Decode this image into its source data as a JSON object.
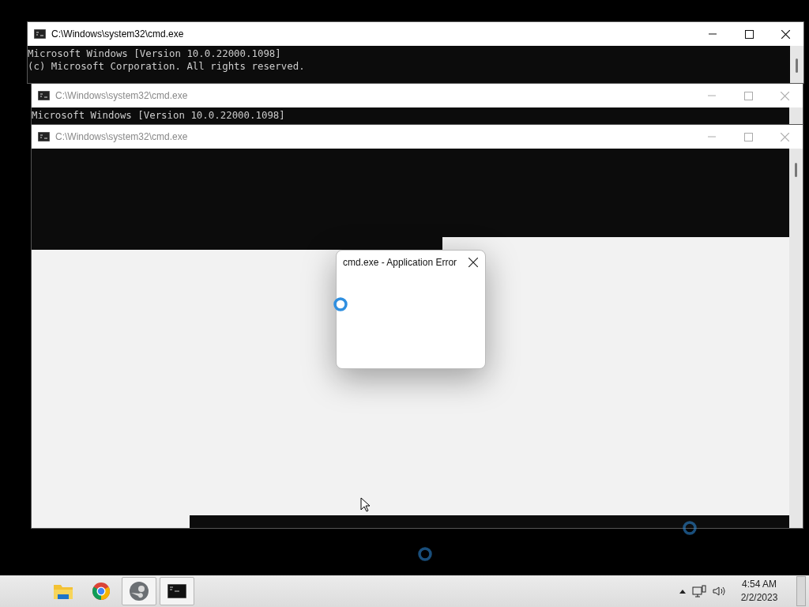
{
  "windows": [
    {
      "title": "C:\\Windows\\system32\\cmd.exe",
      "active": true,
      "lines": [
        "Microsoft Windows [Version 10.0.22000.1098]",
        "(c) Microsoft Corporation. All rights reserved."
      ]
    },
    {
      "title": "C:\\Windows\\system32\\cmd.exe",
      "active": false,
      "lines": [
        "Microsoft Windows [Version 10.0.22000.1098]"
      ]
    },
    {
      "title": "C:\\Windows\\system32\\cmd.exe",
      "active": false
    }
  ],
  "dialog": {
    "title": "cmd.exe - Application Error"
  },
  "taskbar": {
    "apps": [
      {
        "kind": "folder",
        "open": false
      },
      {
        "kind": "browser",
        "open": false
      },
      {
        "kind": "steam",
        "open": true
      },
      {
        "kind": "console",
        "open": true
      }
    ],
    "time": "4:54 AM",
    "date": "2/2/2023"
  }
}
